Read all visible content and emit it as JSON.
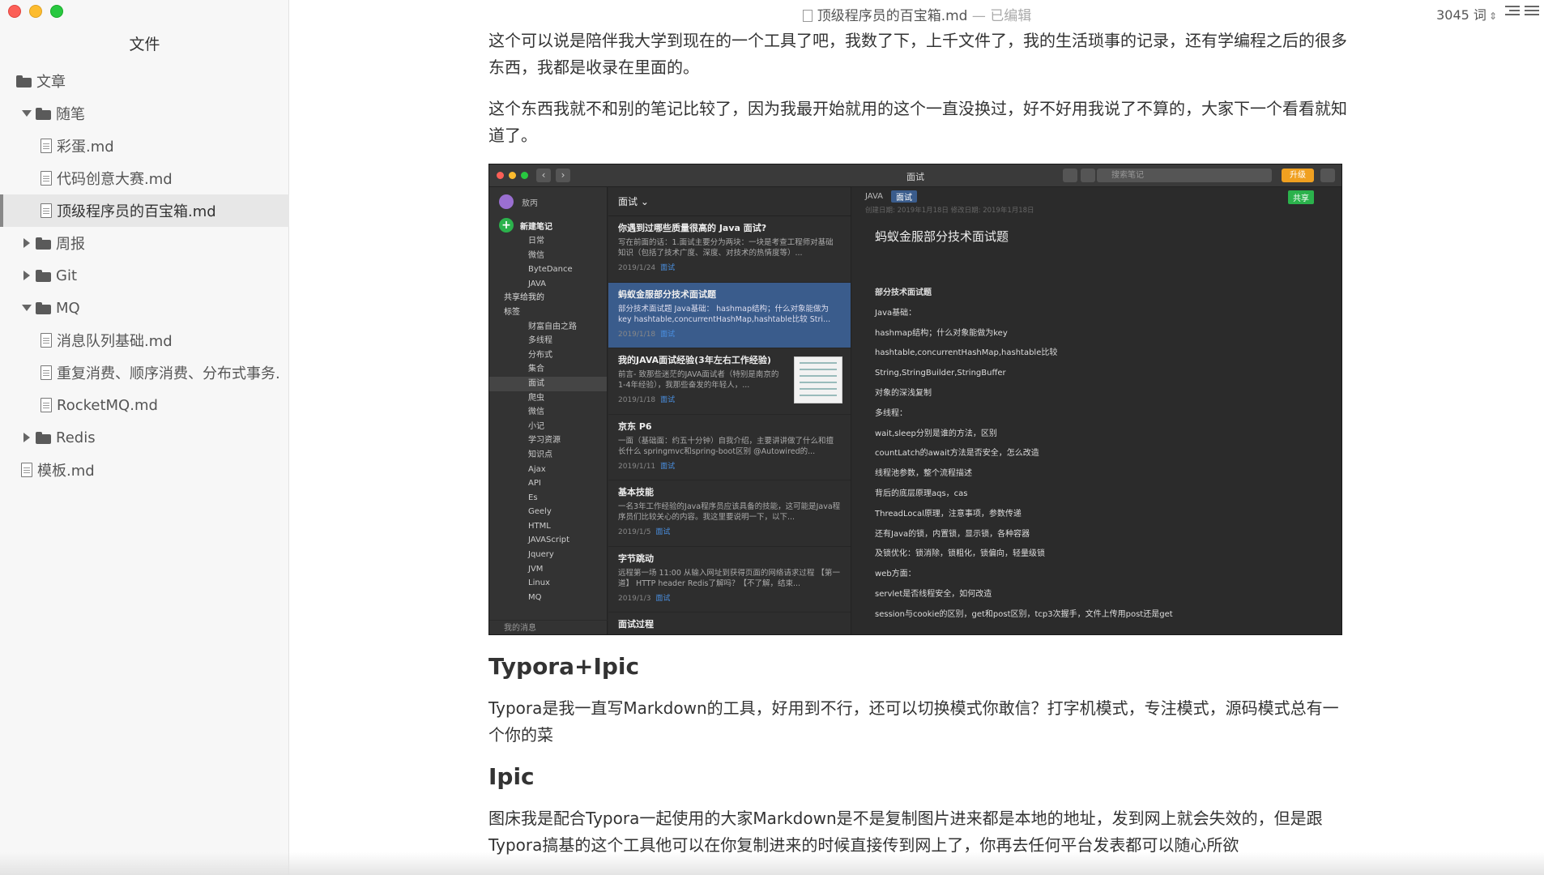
{
  "sidebar": {
    "title": "文件",
    "items": [
      {
        "label": "文章",
        "type": "folder",
        "level": 0,
        "arrow": "none"
      },
      {
        "label": "随笔",
        "type": "folder",
        "level": 1,
        "arrow": "down"
      },
      {
        "label": "彩蛋.md",
        "type": "file",
        "level": 2
      },
      {
        "label": "代码创意大赛.md",
        "type": "file",
        "level": 2
      },
      {
        "label": "顶级程序员的百宝箱.md",
        "type": "file",
        "level": 2,
        "active": true
      },
      {
        "label": "周报",
        "type": "folder",
        "level": 1,
        "arrow": "right"
      },
      {
        "label": "Git",
        "type": "folder",
        "level": 1,
        "arrow": "right"
      },
      {
        "label": "MQ",
        "type": "folder",
        "level": 1,
        "arrow": "down"
      },
      {
        "label": "消息队列基础.md",
        "type": "file",
        "level": 2
      },
      {
        "label": "重复消费、顺序消费、分布式事务.",
        "type": "file",
        "level": 2
      },
      {
        "label": "RocketMQ.md",
        "type": "file",
        "level": 2
      },
      {
        "label": "Redis",
        "type": "folder",
        "level": 1,
        "arrow": "right"
      },
      {
        "label": "模板.md",
        "type": "file",
        "level": 1
      }
    ]
  },
  "titlebar": {
    "doc_name": "顶级程序员的百宝箱.md",
    "edited": " — 已编辑",
    "word_count": "3045 词"
  },
  "content": {
    "para1": "这个可以说是陪伴我大学到现在的一个工具了吧，我数了下，上千文件了，我的生活琐事的记录，还有学编程之后的很多东西，我都是收录在里面的。",
    "para2": "这个东西我就不和别的笔记比较了，因为我最开始就用的这个一直没换过，好不好用我说了不算的，大家下一个看看就知道了。",
    "heading1": "Typora+Ipic",
    "para3": "Typora是我一直写Markdown的工具，好用到不行，还可以切换模式你敢信？打字机模式，专注模式，源码模式总有一个你的菜",
    "heading2": "Ipic",
    "para4": "图床我是配合Typora一起使用的大家Markdown是不是复制图片进来都是本地的地址，发到网上就会失效的，但是跟Typora搞基的这个工具他可以在你复制进来的时候直接传到网上了，你再去任何平台发表都可以随心所欲"
  },
  "screenshot": {
    "window_title": "面试",
    "search_placeholder": "搜索笔记",
    "upgrade_label": "升级",
    "user": "敖丙",
    "new_note": "新建笔记",
    "notebooks": [
      "日常",
      "微信",
      "ByteDance",
      "JAVA"
    ],
    "shared": "共享给我的",
    "tags_label": "标签",
    "tags": [
      "财富自由之路",
      "多线程",
      "分布式",
      "集合",
      "面试",
      "爬虫",
      "微信",
      "小记",
      "学习资源",
      "知识点",
      "Ajax",
      "API",
      "Es",
      "Geely",
      "HTML",
      "JAVAScript",
      "Jquery",
      "JVM",
      "Linux",
      "MQ"
    ],
    "footer": "我的消息",
    "list_header": "面试",
    "notes": [
      {
        "title": "你遇到过哪些质量很高的 Java 面试?",
        "body": "写在前面的话：1.面试主要分为两块：一块是考查工程师对基础知识（包括了技术广度、深度、对技术的热情度等）...",
        "date": "2019/1/24",
        "tag": "面试"
      },
      {
        "title": "蚂蚁金服部分技术面试题",
        "body": "部分技术面试题 Java基础： hashmap结构；什么对象能做为key hashtable,concurrentHashMap,hashtable比较 Stri...",
        "date": "2019/1/18",
        "tag": "面试",
        "selected": true
      },
      {
        "title": "我的JAVA面试经验(3年左右工作经验)",
        "body": "前言- 致那些迷茫的JAVA面试者（特别是南京的1-4年经验），我那些奋发的年轻人，...",
        "date": "2019/1/18",
        "tag": "面试",
        "thumb": true
      },
      {
        "title": "京东 P6",
        "body": "一面（基础面：约五十分钟）自我介绍，主要讲讲做了什么和擅长什么 springmvc和spring-boot区别 @Autowired的...",
        "date": "2019/1/11",
        "tag": "面试"
      },
      {
        "title": "基本技能",
        "body": "一名3年工作经验的Java程序员应该具备的技能，这可能是Java程序员们比较关心的内容。我这里要说明一下，以下...",
        "date": "2019/1/5",
        "tag": "面试"
      },
      {
        "title": "字节跳动",
        "body": "远程第一场 11:00 从输入网址到获得页面的网络请求过程 【第一道】 HTTP header Redis了解吗？【不了解，结束...",
        "date": "2019/1/3",
        "tag": "面试"
      },
      {
        "title": "面试过程",
        "body": "",
        "date": "",
        "tag": ""
      }
    ],
    "detail_notebook": "JAVA",
    "detail_badge": "面试",
    "detail_share": "共享",
    "detail_dates": "创建日期: 2019年1月18日    修改日期: 2019年1月18日",
    "detail_title": "蚂蚁金服部分技术面试题",
    "detail_lines": [
      "部分技术面试题",
      "Java基础：",
      "hashmap结构；什么对象能做为key",
      "hashtable,concurrentHashMap,hashtable比较",
      "String,StringBuilder,StringBuffer",
      "对象的深浅复制",
      "多线程：",
      "wait,sleep分别是谁的方法，区别",
      "countLatch的await方法是否安全，怎么改造",
      "线程池参数，整个流程描述",
      "背后的底层原理aqs，cas",
      "ThreadLocal原理，注意事项，参数传递",
      "还有Java的锁，内置锁，显示锁，各种容器",
      "及锁优化：锁消除，锁粗化，锁偏向，轻量级锁",
      "web方面：",
      "servlet是否线程安全，如何改造",
      "session与cookie的区别，get和post区别，tcp3次握手，文件上传用post还是get"
    ]
  }
}
